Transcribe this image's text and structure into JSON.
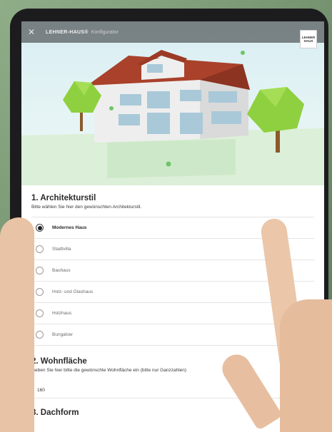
{
  "appbar": {
    "close_glyph": "✕",
    "brand": "LEHNER-HAUS®",
    "subtitle": "Konfigurator",
    "logo_line1": "LEHNER",
    "logo_line2": "HAUS"
  },
  "section1": {
    "title": "1. Architekturstil",
    "subtitle": "Bitte wählen Sie hier den gewünschten Architekturstil.",
    "options": [
      {
        "label": "Modernes Haus",
        "selected": true
      },
      {
        "label": "Stadtvilla",
        "selected": false
      },
      {
        "label": "Bauhaus",
        "selected": false
      },
      {
        "label": "Holz- und Glashaus",
        "selected": false
      },
      {
        "label": "Holzhaus",
        "selected": false
      },
      {
        "label": "Bungalow",
        "selected": false
      }
    ]
  },
  "section2": {
    "title": "2. Wohnfläche",
    "subtitle": "Geben Sie hier bitte die gewünschte Wohnfläche ein (bitte nur Ganzzahlen)",
    "value": "160"
  },
  "section3": {
    "title": "3. Dachform"
  },
  "colors": {
    "roof": "#a9412b",
    "wall": "#f2f2f2",
    "window": "#a9c9d8",
    "tree": "#8ed03f",
    "sky_top": "#dff1f5",
    "ground": "#d9ecd5"
  }
}
